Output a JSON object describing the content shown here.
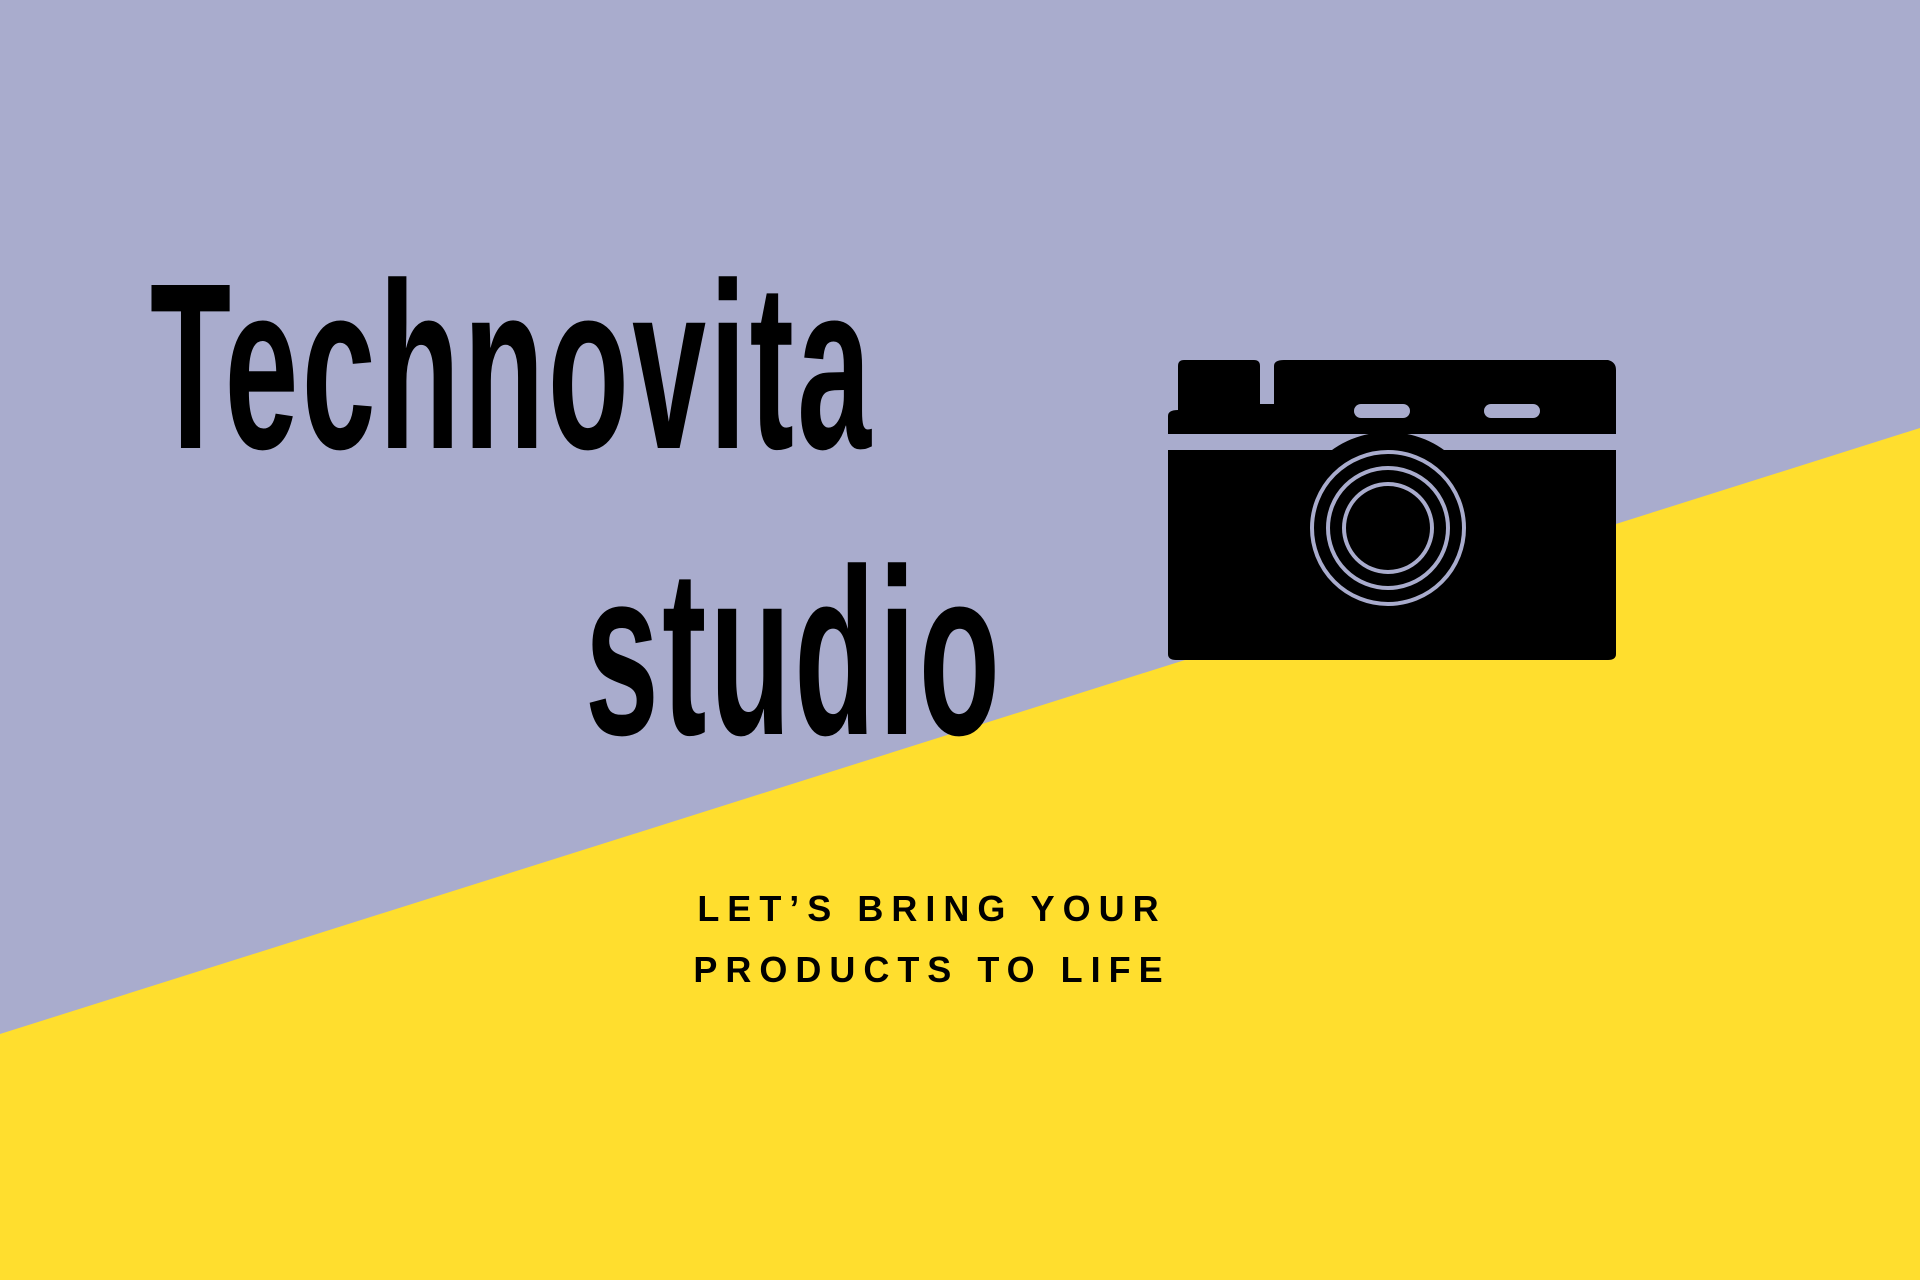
{
  "colors": {
    "top_background": "#A9ACCD",
    "bottom_background": "#FFDE2E",
    "ink": "#000000"
  },
  "brand": {
    "title_line_1": "Technovita",
    "title_line_2": "studio",
    "tagline_line_1": "LET’S BRING YOUR",
    "tagline_line_2": "PRODUCTS TO LIFE"
  },
  "icons": {
    "camera": "camera-icon"
  }
}
